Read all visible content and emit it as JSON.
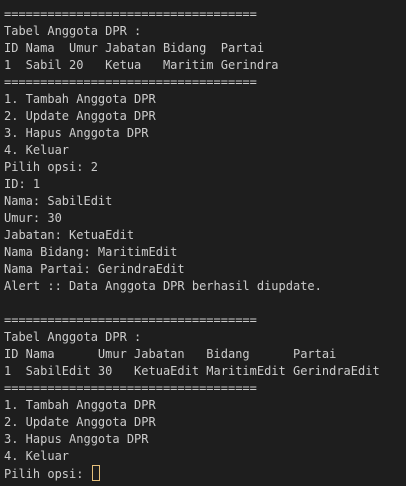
{
  "terminal": {
    "lines": [
      "===================================",
      "Tabel Anggota DPR :",
      "ID Nama  Umur Jabatan Bidang  Partai",
      "1  Sabil 20   Ketua   Maritim Gerindra",
      "===================================",
      "1. Tambah Anggota DPR",
      "2. Update Anggota DPR",
      "3. Hapus Anggota DPR",
      "4. Keluar",
      "Pilih opsi: 2",
      "ID: 1",
      "Nama: SabilEdit",
      "Umur: 30",
      "Jabatan: KetuaEdit",
      "Nama Bidang: MaritimEdit",
      "Nama Partai: GerindraEdit",
      "Alert :: Data Anggota DPR berhasil diupdate.",
      "",
      "===================================",
      "Tabel Anggota DPR :",
      "ID Nama      Umur Jabatan   Bidang      Partai",
      "1  SabilEdit 30   KetuaEdit MaritimEdit GerindraEdit",
      "===================================",
      "1. Tambah Anggota DPR",
      "2. Update Anggota DPR",
      "3. Hapus Anggota DPR",
      "4. Keluar"
    ],
    "prompt": "Pilih opsi: ",
    "colors": {
      "background": "#1e1e1e",
      "text": "#cccccc",
      "cursor": "#e5c07b"
    }
  }
}
